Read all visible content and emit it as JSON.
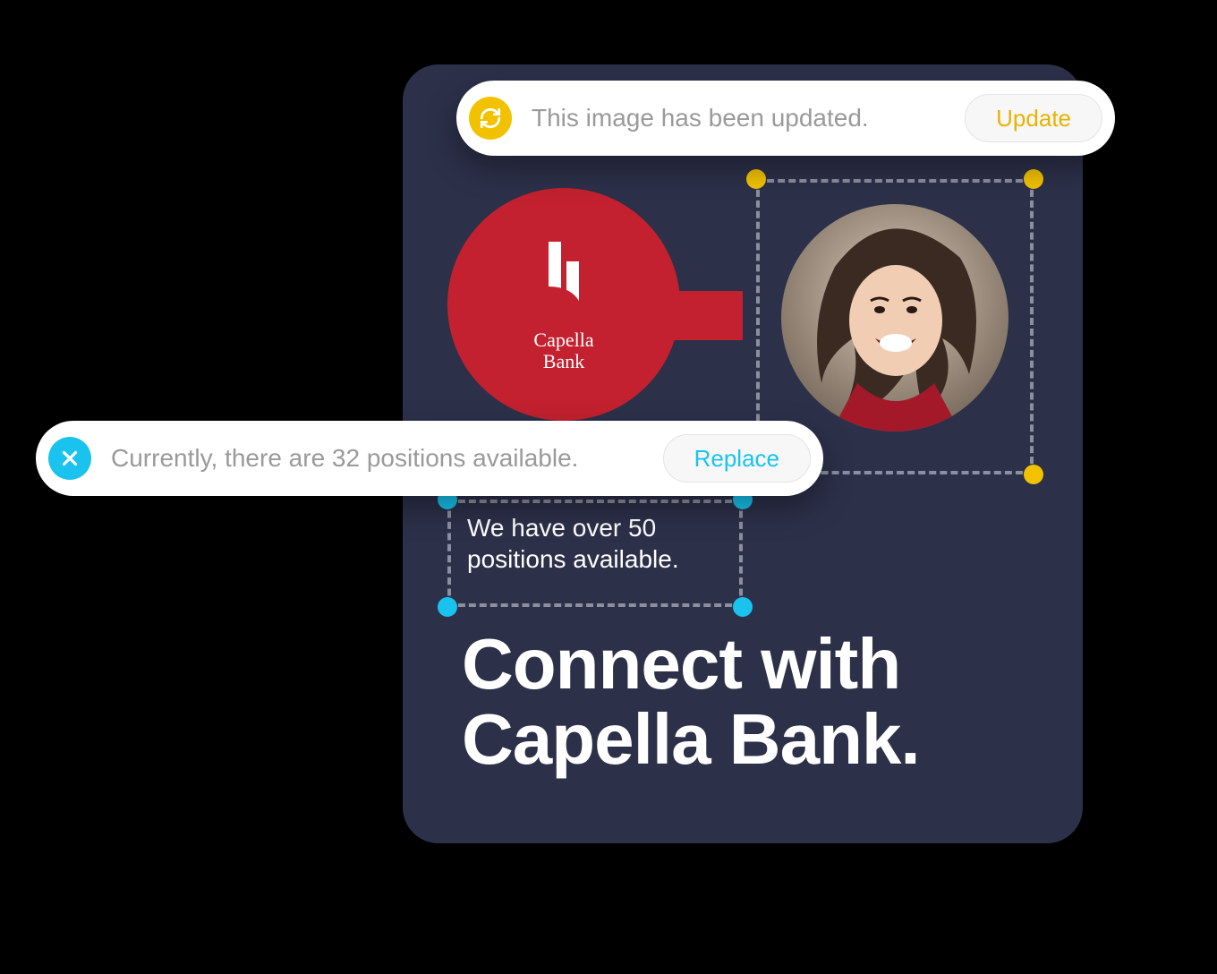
{
  "notifications": {
    "image_update": {
      "message": "This image has been updated.",
      "action_label": "Update",
      "icon": "refresh-icon",
      "accent": "#f2c200"
    },
    "text_replace": {
      "message": "Currently, there are 32 positions available.",
      "action_label": "Replace",
      "icon": "close-icon",
      "accent": "#19c3ee"
    }
  },
  "canvas": {
    "logo": {
      "name_line1": "Capella",
      "name_line2": "Bank"
    },
    "subtext": "We have over 50 positions available.",
    "headline": "Connect with Capella Bank."
  }
}
